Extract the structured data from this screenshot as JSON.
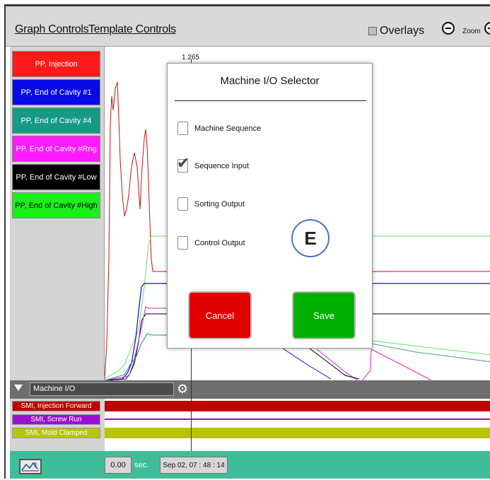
{
  "menubar": {
    "graph_controls": "Graph Controls",
    "template_controls": "Template Controls",
    "overlays_label": "Overlays",
    "zoom_label": "Zoom"
  },
  "legend": {
    "items": [
      {
        "label": "PP, Injection",
        "color": "#ff1a1a",
        "text_color": "#ffffff"
      },
      {
        "label": "PP, End of Cavity #1",
        "color": "#0a0ae6",
        "text_color": "#ffffff"
      },
      {
        "label": "PP, End of Cavity #4",
        "color": "#169a86",
        "text_color": "#ffffff"
      },
      {
        "label": "PP, End of Cavity #Rng",
        "color": "#ff1aff",
        "text_color": "#ffffff"
      },
      {
        "label": "PP, End of Cavity #Low",
        "color": "#000000",
        "text_color": "#ffffff"
      },
      {
        "label": "PP, End of Cavity #High",
        "color": "#1aef1a",
        "text_color": "#000000"
      }
    ]
  },
  "plot": {
    "cursor_value": "1.265"
  },
  "io_panel": {
    "selected": "Machine I/O",
    "signals": [
      {
        "label": "SMI, Injection Forward",
        "color": "#c00000"
      },
      {
        "label": "SMI, Screw Run",
        "color": "#9a0fd0"
      },
      {
        "label": "SMI, Mold Clamped",
        "color": "#b8c400"
      }
    ]
  },
  "footer": {
    "help_icon_text": "?",
    "time_value": "0.00",
    "time_unit": "sec.",
    "timestamp": "Sep 02, 07 : 48 : 14"
  },
  "dialog": {
    "title": "Machine I/O Selector",
    "options": [
      {
        "label": "Machine Sequence",
        "checked": false
      },
      {
        "label": "Sequence Input",
        "checked": true
      },
      {
        "label": "Sorting Output",
        "checked": false
      },
      {
        "label": "Control Output",
        "checked": false
      }
    ],
    "annotation": "E",
    "cancel_label": "Cancel",
    "save_label": "Save",
    "cancel_color": "#e00000",
    "save_color": "#00b000"
  }
}
